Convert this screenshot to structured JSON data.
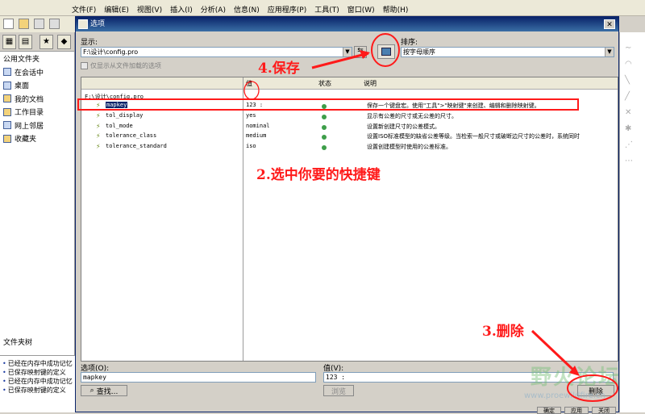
{
  "menubar": {
    "items": [
      "文件(F)",
      "编辑(E)",
      "视图(V)",
      "插入(I)",
      "分析(A)",
      "信息(N)",
      "应用程序(P)",
      "工具(T)",
      "窗口(W)",
      "帮助(H)"
    ]
  },
  "navigator": {
    "header": "公用文件夹",
    "items": [
      "在会话中",
      "桌面",
      "我的文档",
      "工作目录",
      "网上邻居",
      "收藏夹"
    ],
    "file_tree_label": "文件夹树",
    "messages": [
      "已经在内存中成功记忆",
      "已保存映射键的定义",
      "已经在内存中成功记忆",
      "已保存映射键的定义"
    ]
  },
  "dialog": {
    "title": "选项",
    "show_label": "显示:",
    "show_value": "F:\\设计\\config.pro",
    "sort_label": "排序:",
    "sort_value": "按字母顺序",
    "checkbox_label": "仅显示从文件加载的选项",
    "columns": {
      "value": "值",
      "status": "状态",
      "description": "说明"
    },
    "path": "F:\\设计\\config.pro",
    "rows": [
      {
        "name": "mapkey",
        "value": "123 :",
        "desc": "保存一个键盘宏。使用\"工具\">\"映射键\"来创建、编辑和删除映射键。"
      },
      {
        "name": "tol_display",
        "value": "yes",
        "desc": "显示有公差的尺寸或无公差的尺寸。"
      },
      {
        "name": "tol_mode",
        "value": "nominal",
        "desc": "设置新创建尺寸的公差模式。"
      },
      {
        "name": "tolerance_class",
        "value": "medium",
        "desc": "设置ISO标准模型的缺省公差等级。当检索一般尺寸或破断边尺寸的公差时，系统同时"
      },
      {
        "name": "tolerance_standard",
        "value": "iso",
        "desc": "设置创建模型时使用的公差标准。"
      }
    ],
    "option_label": "选项(O):",
    "option_value": "mapkey",
    "value_label": "值(V):",
    "value_value": "123 :",
    "find_button": "查找...",
    "browse_button": "浏览",
    "delete_button": "删除",
    "bottom_buttons": [
      "确定",
      "应用",
      "关闭"
    ]
  },
  "annotations": {
    "save": "4.保存",
    "select": "2.选中你要的快捷键",
    "delete": "3.删除"
  },
  "watermark": {
    "text": "野火论坛",
    "url": "www.proewildfire.cn"
  },
  "colors": {
    "annotation": "#ff1a1a",
    "selection": "#0a246a",
    "status_ok": "#3e9e4a"
  }
}
